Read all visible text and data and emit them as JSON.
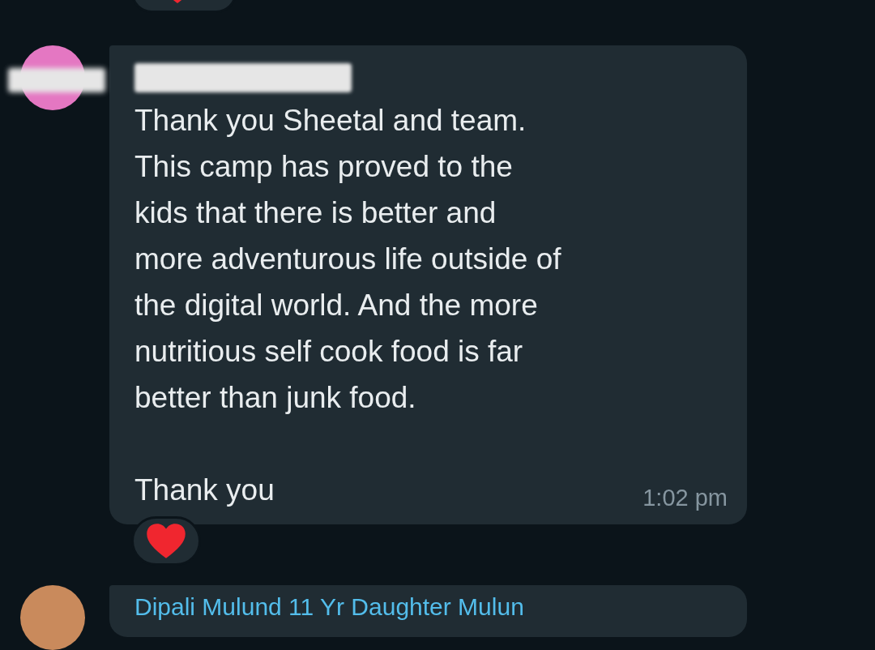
{
  "top_reaction": {
    "kind": "heart"
  },
  "message": {
    "avatar": {
      "color": "#e477c2"
    },
    "sender_redacted": true,
    "body": "Thank you Sheetal and team.\nThis camp has proved to the\nkids that there is better and\nmore adventurous life outside of\nthe digital world. And the more\nnutritious self cook food is far\nbetter than junk food.",
    "closing": "Thank you",
    "time": "1:02 pm",
    "reaction": {
      "kind": "heart"
    }
  },
  "next_message": {
    "sender": "Dipali Mulund 11 Yr Daughter Mulun"
  }
}
